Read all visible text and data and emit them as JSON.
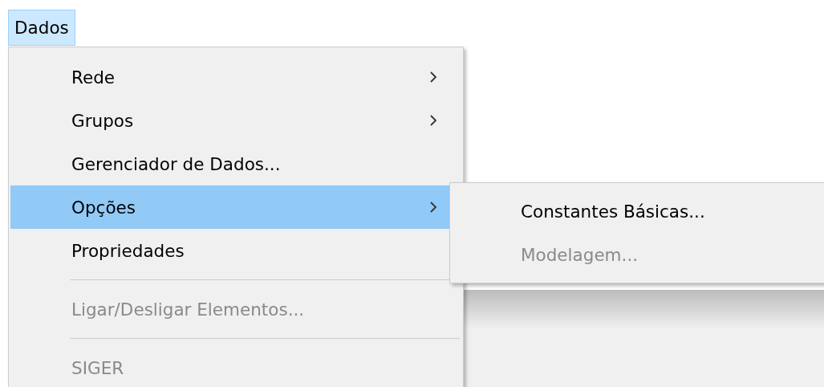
{
  "menu_bar": [
    {
      "label": "Dados",
      "selected": true
    }
  ],
  "menu": {
    "items": [
      {
        "kind": "item",
        "label": "Rede",
        "has_submenu": true,
        "disabled": false,
        "selected": false
      },
      {
        "kind": "item",
        "label": "Grupos",
        "has_submenu": true,
        "disabled": false,
        "selected": false
      },
      {
        "kind": "item",
        "label": "Gerenciador de Dados...",
        "has_submenu": false,
        "disabled": false,
        "selected": false
      },
      {
        "kind": "item",
        "label": "Opções",
        "has_submenu": true,
        "disabled": false,
        "selected": true
      },
      {
        "kind": "item",
        "label": "Propriedades",
        "has_submenu": false,
        "disabled": false,
        "selected": false
      },
      {
        "kind": "separator"
      },
      {
        "kind": "item",
        "label": "Ligar/Desligar Elementos...",
        "has_submenu": false,
        "disabled": true,
        "selected": false
      },
      {
        "kind": "separator"
      },
      {
        "kind": "item",
        "label": "SIGER",
        "has_submenu": false,
        "disabled": true,
        "selected": false
      }
    ]
  },
  "submenu": {
    "items": [
      {
        "kind": "item",
        "label": "Constantes Básicas...",
        "disabled": false,
        "selected": false
      },
      {
        "kind": "item",
        "label": "Modelagem...",
        "disabled": true,
        "selected": false
      }
    ]
  }
}
